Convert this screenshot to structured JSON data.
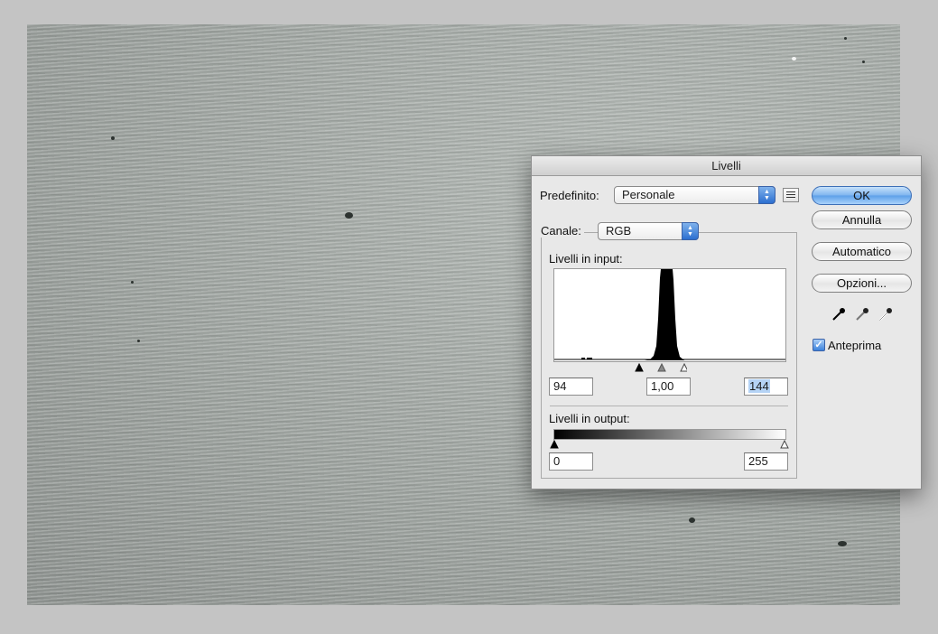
{
  "dialog": {
    "title": "Livelli",
    "preset_label": "Predefinito:",
    "preset_value": "Personale",
    "channel_label": "Canale:",
    "channel_value": "RGB",
    "input_levels_label": "Livelli in input:",
    "input_black": "94",
    "input_gamma": "1,00",
    "input_white": "144",
    "output_levels_label": "Livelli in output:",
    "output_black": "0",
    "output_white": "255",
    "buttons": {
      "ok": "OK",
      "cancel": "Annulla",
      "auto": "Automatico",
      "options": "Opzioni..."
    },
    "preview_label": "Anteprima",
    "preview_checked": true,
    "icons": [
      "preset-menu-icon",
      "black-eyedropper-icon",
      "gray-eyedropper-icon",
      "white-eyedropper-icon"
    ]
  },
  "colors": {
    "accent": "#5c9fe8",
    "canvas": "#9ca29e"
  }
}
